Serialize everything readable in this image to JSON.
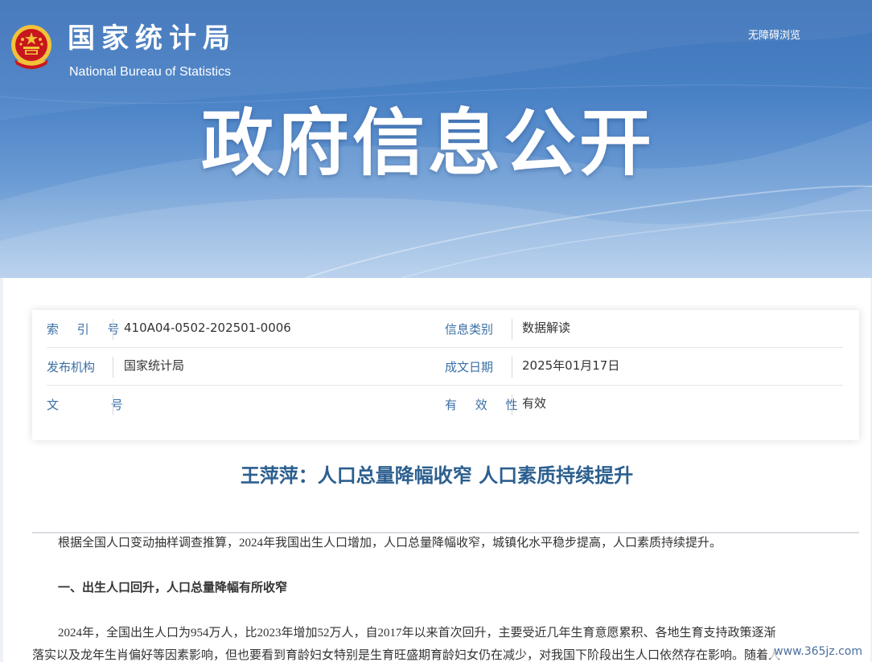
{
  "header": {
    "brand_cn": "国家统计局",
    "brand_en": "National Bureau of Statistics",
    "accessibility_link": "无障碍浏览",
    "banner_title": "政府信息公开",
    "emblem_icon": "national-emblem-icon"
  },
  "meta": {
    "index_label": "索 引 号",
    "index_value": "410A04-0502-202501-0006",
    "category_label": "信息类别",
    "category_value": "数据解读",
    "publisher_label": "发布机构",
    "publisher_value": "国家统计局",
    "date_label": "成文日期",
    "date_value": "2025年01月17日",
    "doc_no_label": "文 号",
    "doc_no_value": "",
    "validity_label": "有 效 性",
    "validity_value": "有效"
  },
  "article": {
    "title": "王萍萍：人口总量降幅收窄 人口素质持续提升",
    "paragraphs": [
      "根据全国人口变动抽样调查推算，2024年我国出生人口增加，人口总量降幅收窄，城镇化水平稳步提高，人口素质持续提升。",
      "一、出生人口回升，人口总量降幅有所收窄",
      "2024年，全国出生人口为954万人，比2023年增加52万人，自2017年以来首次回升，主要受近几年生育意愿累积、各地生育支持政策逐渐",
      "落实以及龙年生肖偏好等因素影响，但也要看到育龄妇女特别是生育旺盛期育龄妇女仍在减少，对我国下阶段出生人口依然存在影响。随着人"
    ]
  },
  "watermark": "www.365jz.com",
  "colors": {
    "banner_top": "#3f74b9",
    "label_blue": "#3a6ea5",
    "title_blue": "#2c5f8f",
    "emblem_red": "#c8161d",
    "emblem_gold": "#f2c23a"
  }
}
